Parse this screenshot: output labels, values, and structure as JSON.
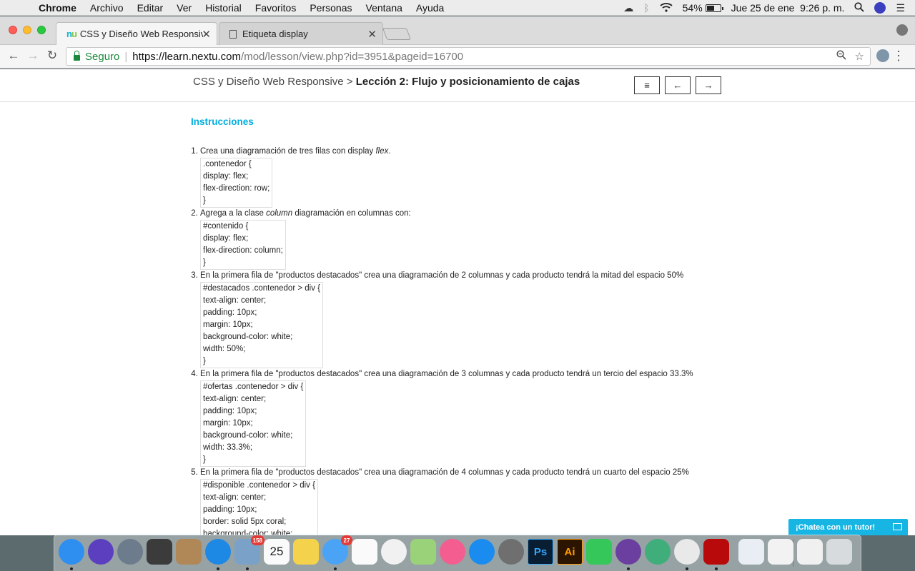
{
  "menubar": {
    "app_name": "Chrome",
    "items": [
      "Archivo",
      "Editar",
      "Ver",
      "Historial",
      "Favoritos",
      "Personas",
      "Ventana",
      "Ayuda"
    ],
    "battery": "54%",
    "datetime": "Jue 25 de ene  9:26 p. m."
  },
  "tabs": [
    {
      "favicon": "nu",
      "title": "CSS y Diseño Web Responsive",
      "active": true
    },
    {
      "favicon": "page-icon",
      "title": "Etiqueta display",
      "active": false
    }
  ],
  "omnibox": {
    "secure_label": "Seguro",
    "url_host": "https://learn.nextu.com",
    "url_path": "/mod/lesson/view.php?id=3951&pageid=16700"
  },
  "page": {
    "breadcrumb_course": "CSS y Diseño Web Responsive >",
    "breadcrumb_lesson": "Lección 2: Flujo y posicionamiento de cajas",
    "btn_menu": "≡",
    "btn_prev": "←",
    "btn_next": "→",
    "heading": "Instrucciones",
    "steps": [
      {
        "text_before": "Crea una diagramación de tres filas con display ",
        "em": "flex",
        "text_after": ".",
        "code": [
          ".contenedor {",
          "display: flex;",
          "flex-direction: row;",
          "}"
        ]
      },
      {
        "text_before": "Agrega a la clase ",
        "em": "column",
        "text_after": " diagramación en columnas con:",
        "code": [
          "#contenido {",
          "display: flex;",
          "flex-direction: column;",
          "}"
        ]
      },
      {
        "text_before": "En la primera fila de \"productos destacados\" crea una diagramación de 2 columnas y cada producto tendrá la mitad del espacio 50%",
        "em": "",
        "text_after": "",
        "code": [
          "#destacados .contenedor > div {",
          "text-align: center;",
          "padding: 10px;",
          "margin: 10px;",
          "background-color: white;",
          "width: 50%;",
          "}"
        ]
      },
      {
        "text_before": "En la primera fila de \"productos destacados\" crea una diagramación de 3 columnas y cada producto tendrá un tercio del espacio 33.3%",
        "em": "",
        "text_after": "",
        "code": [
          "#ofertas .contenedor > div {",
          "text-align: center;",
          "padding: 10px;",
          "margin: 10px;",
          "background-color: white;",
          "width: 33.3%;",
          "}"
        ]
      },
      {
        "text_before": "En la primera fila de \"productos destacados\" crea una diagramación de 4 columnas y cada producto tendrá un cuarto del espacio 25%",
        "em": "",
        "text_after": "",
        "code": [
          "#disponible .contenedor > div {",
          "text-align: center;",
          "padding: 10px;",
          "border: solid 5px coral;",
          "background-color: white;"
        ]
      }
    ],
    "chat_label": "¡Chatea con un tutor!"
  },
  "dock": {
    "items": [
      {
        "name": "finder-icon",
        "color": "#2e8ff0",
        "label": "",
        "running": true
      },
      {
        "name": "siri-icon",
        "color": "#5b3fbf",
        "label": "",
        "running": false
      },
      {
        "name": "launchpad-icon",
        "color": "#6d7c8c",
        "label": "",
        "running": false
      },
      {
        "name": "dashboard-icon",
        "color": "#3b3b3b",
        "label": "",
        "running": false
      },
      {
        "name": "notes-folder-icon",
        "color": "#b08857",
        "label": "",
        "running": false
      },
      {
        "name": "safari-icon",
        "color": "#1e88e5",
        "label": "",
        "running": true
      },
      {
        "name": "mail-icon",
        "color": "#7aa2c8",
        "label": "",
        "running": true,
        "badge": "158"
      },
      {
        "name": "calendar-icon",
        "color": "#fafafa",
        "label": "25",
        "running": false
      },
      {
        "name": "notes-icon",
        "color": "#f4d24b",
        "label": "",
        "running": false
      },
      {
        "name": "messages-icon",
        "color": "#4aa3f5",
        "label": "",
        "running": true,
        "badge": "27"
      },
      {
        "name": "reminders-icon",
        "color": "#fafafa",
        "label": "",
        "running": false
      },
      {
        "name": "photos-icon",
        "color": "#f1f1f1",
        "label": "",
        "running": false
      },
      {
        "name": "maps-icon",
        "color": "#9ad27a",
        "label": "",
        "running": false
      },
      {
        "name": "itunes-icon",
        "color": "#f35d8f",
        "label": "",
        "running": false
      },
      {
        "name": "appstore-icon",
        "color": "#1a8cf0",
        "label": "",
        "running": false
      },
      {
        "name": "system-preferences-icon",
        "color": "#6f6f6f",
        "label": "",
        "running": false
      },
      {
        "name": "photoshop-icon",
        "color": "#0a1e33",
        "label": "Ps",
        "running": false
      },
      {
        "name": "illustrator-icon",
        "color": "#2b1500",
        "label": "Ai",
        "running": false
      },
      {
        "name": "facetime-icon",
        "color": "#35c759",
        "label": "",
        "running": false
      },
      {
        "name": "github-icon",
        "color": "#6b3fa0",
        "label": "",
        "running": true
      },
      {
        "name": "atom-icon",
        "color": "#3fae7b",
        "label": "",
        "running": false
      },
      {
        "name": "chrome-icon",
        "color": "#e9e9e9",
        "label": "",
        "running": true
      },
      {
        "name": "acrobat-icon",
        "color": "#b80a0a",
        "label": "",
        "running": true
      },
      {
        "name": "screenshot-thumb-1-icon",
        "color": "#e9eef5",
        "label": "",
        "running": false
      },
      {
        "name": "screenshot-thumb-2-icon",
        "color": "#f2f2f2",
        "label": "",
        "running": false
      },
      {
        "name": "downloads-stack-icon",
        "color": "#f0f0f0",
        "label": "",
        "running": false
      },
      {
        "name": "trash-icon",
        "color": "#d7dbde",
        "label": "",
        "running": false
      }
    ]
  }
}
